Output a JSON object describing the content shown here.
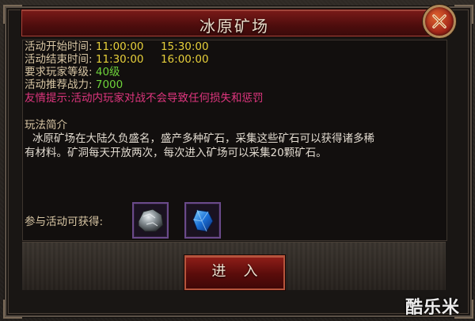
{
  "window": {
    "title": "冰原矿场",
    "close_icon": "close-x-icon"
  },
  "info": {
    "start_label": "活动开始时间:",
    "start_time_1": "11:00:00",
    "start_time_2": "15:30:00",
    "end_label": "活动结束时间:",
    "end_time_1": "11:30:00",
    "end_time_2": "16:00:00",
    "level_label": "要求玩家等级:",
    "level_value": "40级",
    "power_label": "活动推荐战力:",
    "power_value": "7000",
    "tip": "友情提示:活动内玩家对战不会导致任何损失和惩罚"
  },
  "intro": {
    "title": "玩法简介",
    "line1": "冰原矿场在大陆久负盛名，盛产多种矿石，采集这些矿石可以获得诸多稀",
    "line2": "有材料。矿洞每天开放两次，每次进入矿场可以采集20颗矿石。"
  },
  "rewards": {
    "label": "参与活动可获得:",
    "items": [
      {
        "icon": "silver-ore-icon"
      },
      {
        "icon": "blue-crystal-icon"
      }
    ]
  },
  "actions": {
    "enter_label": "进入"
  },
  "watermark": "酷乐米",
  "colors": {
    "accent_red": "#8f1e18",
    "label": "#d8c6a4",
    "time_yellow": "#e6cf3a",
    "value_green": "#6ed23a",
    "tip_pink": "#e0367f"
  }
}
